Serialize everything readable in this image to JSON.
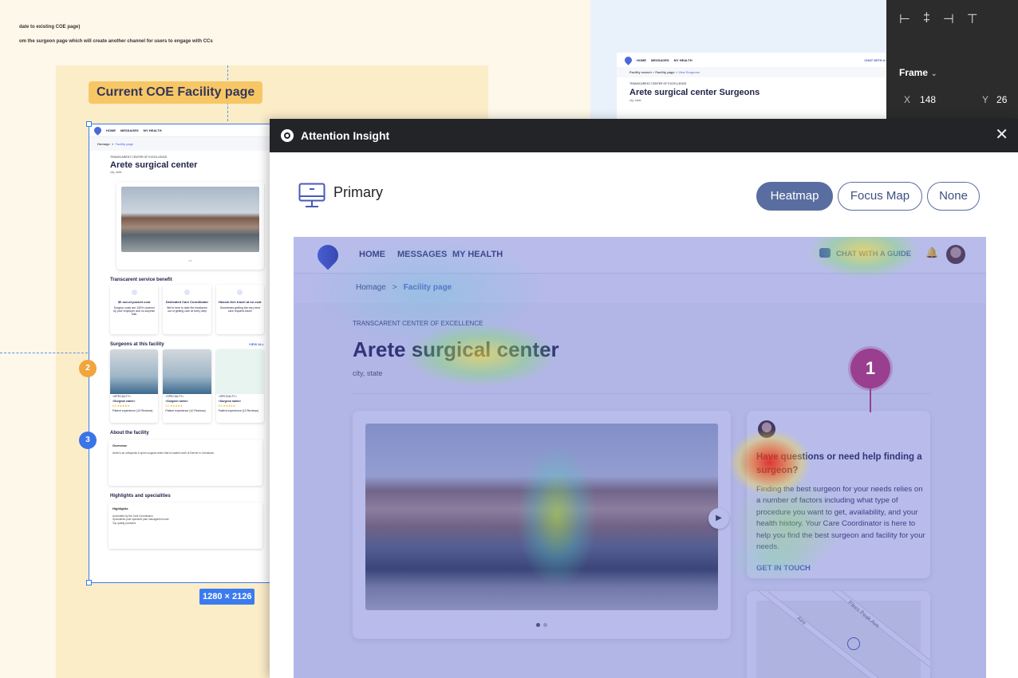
{
  "canvas": {
    "note_1": "date to existing COE page)",
    "note_2": "om the surgeon page which will create another channel for users to engage with CCs",
    "section_label": "Current COE Facility page",
    "frame_size": "1280 × 2126",
    "badges": [
      "2",
      "3"
    ]
  },
  "mini_page": {
    "nav": [
      "HOME",
      "MESSAGES",
      "MY HEALTH"
    ],
    "breadcrumb_home": "Homage",
    "breadcrumb_sep": ">",
    "breadcrumb_current": "Facility page",
    "tag": "TRANSCARENT CENTER OF EXCELLENCE",
    "title": "Arete surgical center",
    "subtitle": "city, state",
    "dots": "• •",
    "benefits_heading": "Transcarent service benefit",
    "benefits": [
      {
        "title": "$0 out-of-pocket cost",
        "text": "Surgery costs are 100% covered by your employer and no surprise bills"
      },
      {
        "title": "Dedicated Care Coordinator",
        "text": "We're here to take the headache out of getting care at every step"
      },
      {
        "title": "Hassle-free travel at no cost",
        "text": "Sometimes getting the very best care requires travel"
      }
    ],
    "surgeons_heading": "Surgeons at this facility",
    "view_all": "VIEW ALL",
    "surgeons": [
      {
        "specialty": "<SPECIALTY>",
        "name": "<Surgeon name>",
        "rating": "5.0 ★★★★★",
        "exp": "Patient experience (10 Reviews)"
      },
      {
        "specialty": "<SPECIALTY>",
        "name": "<Surgeon name>",
        "rating": "5.0 ★★★★★",
        "exp": "Patient experience (10 Reviews)"
      },
      {
        "specialty": "<SPECIALTY>",
        "name": "<Surgeon name>",
        "rating": "5.0 ★★★★★",
        "exp": "Patient experience (10 Reviews)"
      }
    ],
    "about_heading": "About the facility",
    "overview_title": "Overview",
    "overview_text": "Arete is an orthopedic & spine surgical center that is located north of Denver in Johnstown.",
    "highlights_heading": "Highlights and specialities",
    "highlights_title": "Highlights",
    "highlights": [
      "Accredited by the Joint Commission",
      "Specialized post operative pain management care",
      "Top quality providers"
    ]
  },
  "preview": {
    "nav": [
      "HOME",
      "MESSAGES",
      "MY HEALTH"
    ],
    "chat": "CHAT WITH A GUIDE",
    "breadcrumb_a": "Facility search",
    "breadcrumb_b": "Facility page",
    "breadcrumb_c": "View Surgeons",
    "tag": "TRANSCARENT CENTER OF EXCELLENCE",
    "title": "Arete surgical center Surgeons",
    "subtitle": "city, state"
  },
  "props_panel": {
    "align_icons": [
      "align-left-icon",
      "align-center-icon",
      "align-right-icon",
      "align-top-icon"
    ],
    "align_glyphs": [
      "⊢",
      "‡",
      "⊣",
      "⊤"
    ],
    "frame_label": "Frame",
    "caret": "⌄",
    "x_label": "X",
    "x_value": "148",
    "y_label": "Y",
    "y_value": "26"
  },
  "modal": {
    "app_title": "Attention Insight",
    "close": "✕",
    "device_label": "Primary",
    "tabs": {
      "heatmap": "Heatmap",
      "focus_map": "Focus Map",
      "none": "None"
    },
    "active_tab": "heatmap"
  },
  "analyzed_page": {
    "nav": {
      "home": "HOME",
      "messages": "MESSAGES",
      "my_health": "MY HEALTH"
    },
    "chat": "CHAT WITH A GUIDE",
    "bell": "🔔",
    "breadcrumb": {
      "home": "Homage",
      "sep": ">",
      "current": "Facility page"
    },
    "tag": "TRANSCARENT CENTER OF EXCELLENCE",
    "title": "Arete surgical center",
    "subtitle": "city, state",
    "next_arrow": "▶",
    "help_title": "Have questions or need help finding a surgeon?",
    "help_body": "Finding the best surgeon for your needs relies on a number of factors including what type of procedure you want to get, availability, and your health history. Your Care Coordinator is here to help you find the best surgeon and facility for your needs.",
    "help_link": "GET IN TOUCH",
    "map_streets": [
      "Aire",
      "Pikes Peak Ave"
    ],
    "focus_point": "1"
  },
  "colors": {
    "accent": "#4a5ab8",
    "figma_blue": "#3b7bef",
    "focus_pin": "#9a3f8f",
    "heatmap_button": "#5a6da0"
  }
}
